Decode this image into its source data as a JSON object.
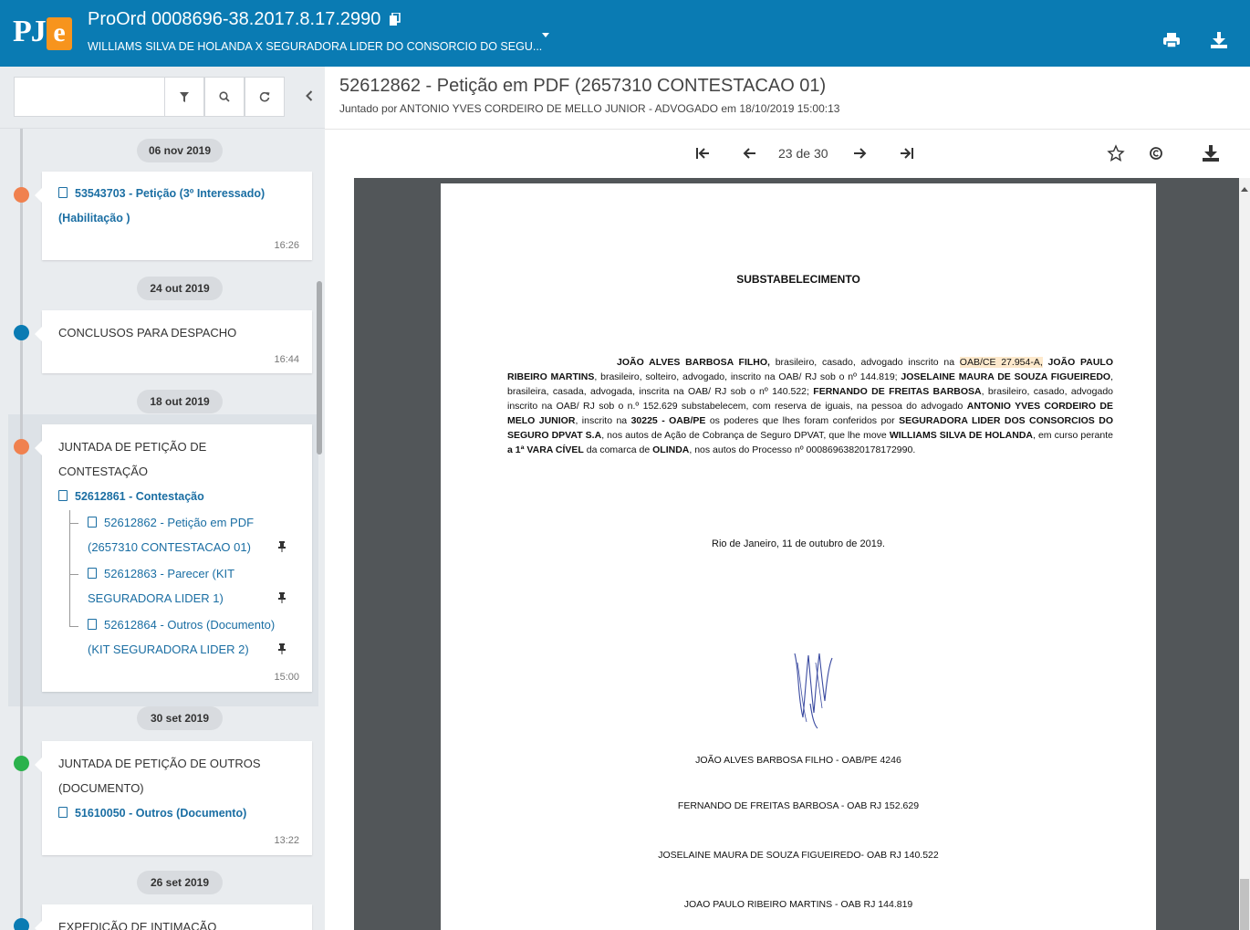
{
  "header": {
    "logo_pj": "PJ",
    "logo_e": "e",
    "title": "ProOrd 0008696-38.2017.8.17.2990",
    "subtitle": "WILLIAMS SILVA DE HOLANDA X SEGURADORA LIDER DO CONSORCIO DO SEGU...",
    "bg_color": "#0a7bb3"
  },
  "sidebar": {
    "dates": [
      "06 nov 2019",
      "24 out 2019",
      "18 out 2019",
      "30 set 2019",
      "26 set 2019"
    ],
    "events": [
      {
        "link": "53543703 - Petição (3º Interessado)",
        "link2": "(Habilitação )",
        "time": "16:26",
        "dot_color": "#f0814f"
      },
      {
        "text": "CONCLUSOS PARA DESPACHO",
        "time": "16:44",
        "dot_color": "#0a7bb3"
      },
      {
        "text": "JUNTADA DE PETIÇÃO DE",
        "text2": "CONTESTAÇÃO",
        "link": "52612861 - Contestação",
        "subdocs": [
          {
            "line1": "52612862 - Petição em PDF",
            "line2": "(2657310 CONTESTACAO 01)"
          },
          {
            "line1": "52612863 - Parecer (KIT",
            "line2": "SEGURADORA LIDER 1)"
          },
          {
            "line1": "52612864 - Outros (Documento)",
            "line2": "(KIT SEGURADORA LIDER 2)"
          }
        ],
        "time": "15:00",
        "dot_color": "#f0814f"
      },
      {
        "text": "JUNTADA DE PETIÇÃO DE OUTROS",
        "text2": "(DOCUMENTO)",
        "link": "51610050 - Outros (Documento)",
        "time": "13:22",
        "dot_color": "#2bb24c"
      },
      {
        "text": "EXPEDIÇÃO DE INTIMAÇÃO",
        "dot_color": "#0a7bb3"
      }
    ]
  },
  "main": {
    "doc_title": "52612862 - Petição em PDF (2657310 CONTESTACAO 01)",
    "doc_sub": "Juntado por ANTONIO YVES CORDEIRO DE MELLO JUNIOR - ADVOGADO em 18/10/2019 15:00:13",
    "page_current": "23",
    "page_sep": "de",
    "page_total": "30"
  },
  "pdf": {
    "heading": "SUBSTABELECIMENTO",
    "body": {
      "n1": "JOÃO ALVES BARBOSA FILHO,",
      "t1": " brasileiro, casado, advogado inscrito na ",
      "oab1": "OAB/CE 27.954-A,",
      "n2": " JOÃO PAULO RIBEIRO MARTINS",
      "t2": ", brasileiro, solteiro, advogado, inscrito na OAB/ RJ sob o nº 144.819; ",
      "n3": "JOSELAINE MAURA DE SOUZA FIGUEIREDO",
      "t3": ", brasileira, casada, advogada, inscrita na OAB/ RJ sob o nº 140.522; ",
      "n4": "FERNANDO DE FREITAS BARBOSA",
      "t4": ", brasileiro, casado, advogado inscrito na OAB/ RJ sob o n.º 152.629 substabelecem, com reserva de iguais, na pessoa do advogado ",
      "n5": "ANTONIO YVES CORDEIRO DE MELO JUNIOR",
      "t5": ", inscrito na ",
      "n6": "30225 - OAB/PE",
      "t6": " os poderes que lhes foram conferidos por ",
      "n7": "SEGURADORA LIDER DOS CONSORCIOS DO SEGURO DPVAT S.A",
      "t7": ", nos autos de Ação de Cobrança de Seguro DPVAT, que lhe move ",
      "n8": "WILLIAMS SILVA DE HOLANDA",
      "t8": ", em curso perante ",
      "n9": "a 1ª VARA CÍVEL",
      "t9": " da comarca de ",
      "n10": "OLINDA",
      "t10": ", nos autos do Processo nº 00086963820178172990."
    },
    "date_line": "Rio de Janeiro, 11 de outubro de 2019.",
    "signatories": [
      "JOÃO ALVES BARBOSA FILHO - OAB/PE 4246",
      "FERNANDO DE FREITAS BARBOSA - OAB RJ 152.629",
      "JOSELAINE MAURA DE SOUZA FIGUEIREDO- OAB RJ 140.522",
      "JOAO PAULO RIBEIRO MARTINS - OAB RJ 144.819"
    ]
  }
}
